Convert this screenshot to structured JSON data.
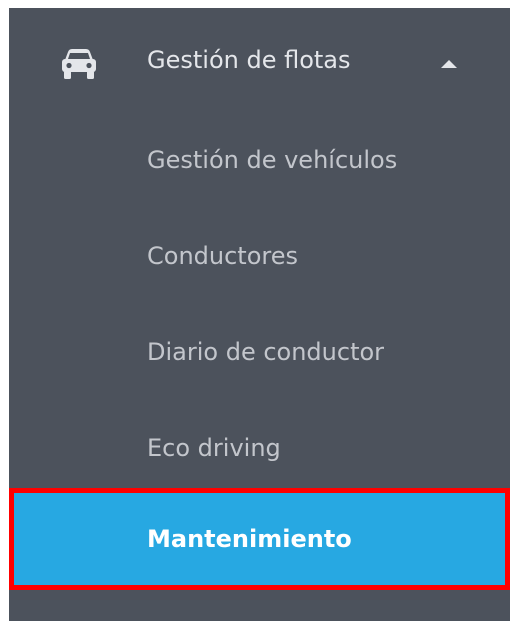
{
  "menu": {
    "section_label": "Gestión de flotas",
    "section_icon": "car-icon",
    "expand_icon": "caret-up-icon",
    "items": [
      {
        "label": "Gestión de vehículos"
      },
      {
        "label": "Conductores"
      },
      {
        "label": "Diario de conductor"
      },
      {
        "label": "Eco driving"
      }
    ],
    "active_item": {
      "label": "Mantenimiento"
    }
  },
  "colors": {
    "sidebar_background": "#4c525c",
    "active_background": "#27a8e2",
    "highlight_border": "#ff0000",
    "text": "#c3c6cc",
    "active_text": "#ffffff"
  }
}
